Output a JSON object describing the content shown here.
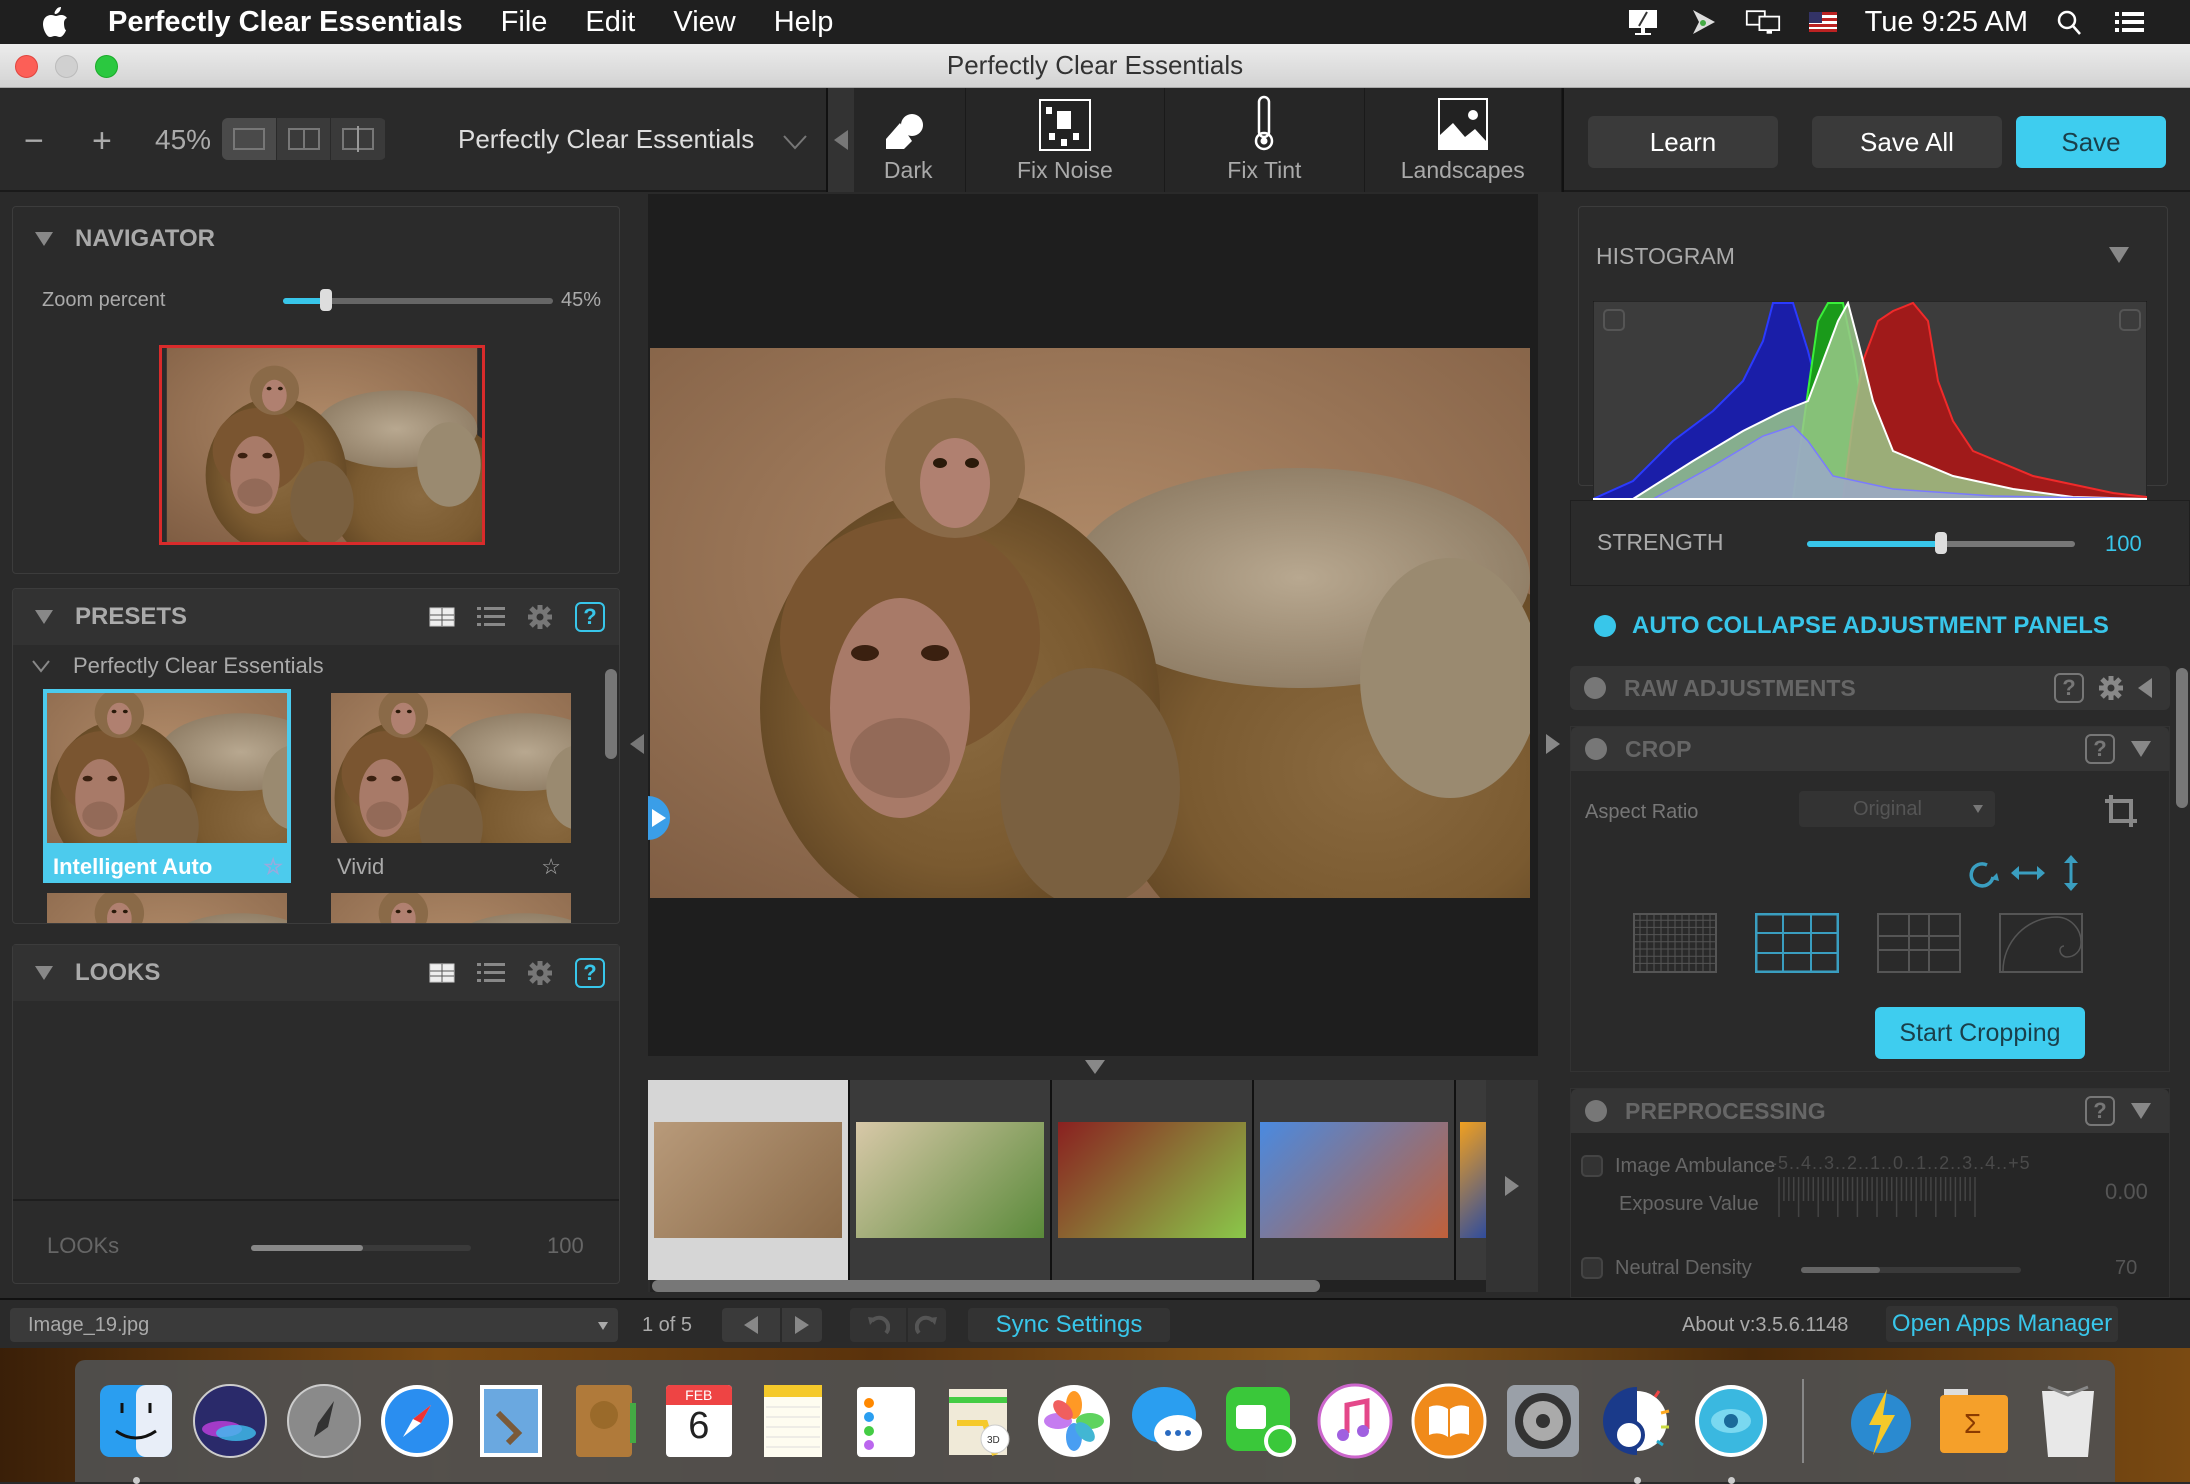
{
  "menubar": {
    "app_name": "Perfectly Clear Essentials",
    "menus": [
      "File",
      "Edit",
      "View",
      "Help"
    ],
    "clock": "Tue 9:25 AM",
    "status_icons": [
      "display-mirroring-icon",
      "location-arrow-icon",
      "screens-icon",
      "us-flag-icon",
      "spotlight-search-icon",
      "notification-center-icon"
    ]
  },
  "window": {
    "title": "Perfectly Clear Essentials"
  },
  "toolbar": {
    "zoom_out": "−",
    "zoom_in": "+",
    "zoom_level": "45%",
    "view_modes": [
      "single-view",
      "side-by-side",
      "split-view"
    ],
    "preset_group": "Perfectly Clear Essentials",
    "preset_strip": [
      {
        "label": "Dark",
        "icon": "dark-icon"
      },
      {
        "label": "Fix Noise",
        "icon": "noise-icon"
      },
      {
        "label": "Fix Tint",
        "icon": "thermometer-icon"
      },
      {
        "label": "Landscapes",
        "icon": "landscape-icon"
      }
    ],
    "learn_label": "Learn",
    "save_all_label": "Save All",
    "save_label": "Save"
  },
  "navigator": {
    "title": "NAVIGATOR",
    "zoom_label": "Zoom percent",
    "zoom_value": "45%",
    "zoom_fraction": 0.16
  },
  "presets": {
    "title": "PRESETS",
    "group": "Perfectly Clear Essentials",
    "items": [
      {
        "label": "Intelligent Auto",
        "selected": true
      },
      {
        "label": "Vivid",
        "selected": false
      }
    ]
  },
  "looks": {
    "title": "LOOKS",
    "slider_label": "LOOKs",
    "slider_value": "100",
    "slider_fraction": 0.51
  },
  "histogram": {
    "title": "HISTOGRAM"
  },
  "strength": {
    "label": "STRENGTH",
    "value": "100",
    "fraction": 0.5
  },
  "auto_collapse": {
    "label": "AUTO COLLAPSE ADJUSTMENT PANELS"
  },
  "raw_adjustments": {
    "title": "RAW ADJUSTMENTS"
  },
  "crop": {
    "title": "CROP",
    "aspect_label": "Aspect Ratio",
    "aspect_value": "Original",
    "overlays": [
      "fine-grid",
      "rule-of-thirds",
      "golden-ratio-grid",
      "golden-spiral"
    ],
    "selected_overlay": "rule-of-thirds",
    "start_label": "Start Cropping"
  },
  "preprocessing": {
    "title": "PREPROCESSING",
    "ambulance_label": "Image Ambulance",
    "exposure_label": "Exposure Value",
    "exposure_scale": "-5..4..3..2..1..0..1..2..3..4..+5",
    "exposure_value": "0.00",
    "nd_label": "Neutral Density",
    "nd_value": "70",
    "nd_fraction": 0.36
  },
  "filmstrip": {
    "thumbnails": [
      "baboons",
      "letters-art",
      "ladybug-drops",
      "canyon-sky",
      "abstract-orange"
    ]
  },
  "status": {
    "filename": "Image_19.jpg",
    "page": "1 of 5",
    "sync_label": "Sync Settings",
    "about": "About v:3.5.6.1148",
    "apps_manager_label": "Open Apps Manager"
  },
  "dock": {
    "apps": [
      "Finder",
      "Siri",
      "Launchpad",
      "Safari",
      "Mail",
      "Contacts",
      "Calendar",
      "Notes",
      "Reminders",
      "Maps",
      "Photos",
      "Messages",
      "FaceTime",
      "iTunes",
      "iBooks",
      "System Preferences",
      "Perfectly Clear",
      "Eyeq",
      "Flash Drive",
      "Sigma Folder",
      "Trash"
    ],
    "calendar_month": "FEB",
    "calendar_day": "6"
  },
  "colors": {
    "accent": "#38c6ea",
    "panel_bg": "#2a2a2a",
    "selected_thumb": "#4ccbed",
    "nav_frame": "#d92b2b"
  }
}
